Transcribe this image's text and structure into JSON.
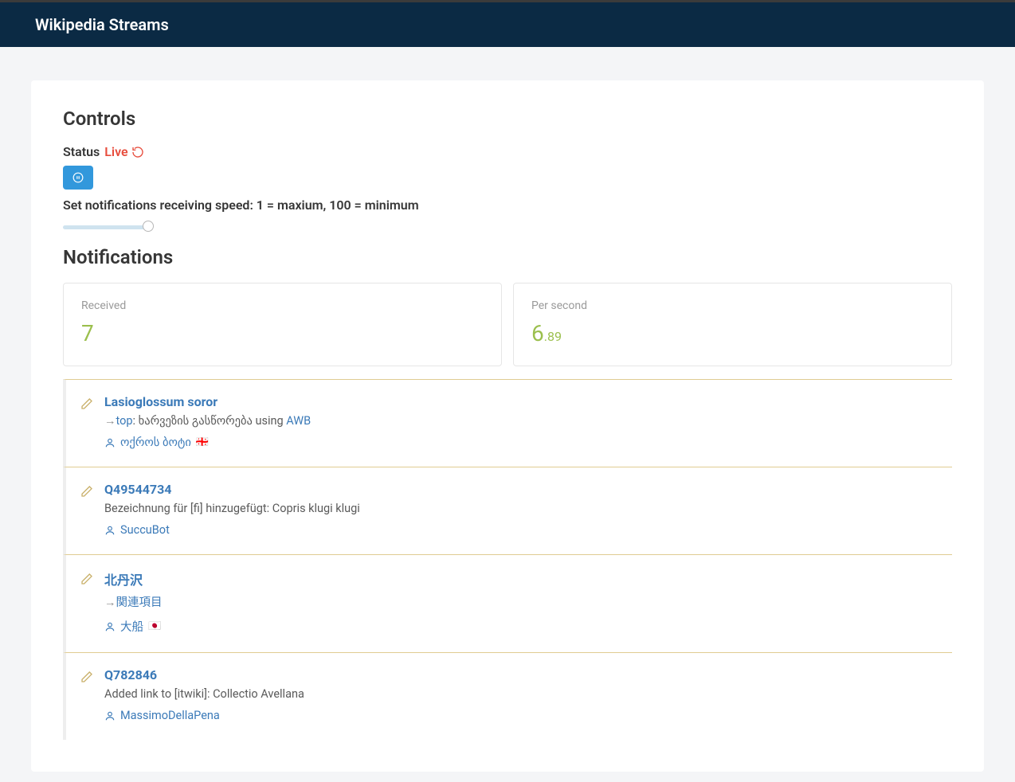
{
  "header": {
    "title": "Wikipedia Streams"
  },
  "controls": {
    "section_title": "Controls",
    "status_label": "Status",
    "status_value": "Live",
    "speed_label": "Set notifications receiving speed: 1 = maxium, 100 = minimum",
    "slider_value": 100
  },
  "notifications": {
    "section_title": "Notifications",
    "stats": {
      "received_label": "Received",
      "received_value": "7",
      "persec_label": "Per second",
      "persec_big": "6",
      "persec_small": ".89"
    },
    "items": [
      {
        "title": "Lasioglossum soror",
        "desc_prefix_arrow": "→",
        "desc_link1": "top",
        "desc_mid": ": ხარვეზის გასწორება using ",
        "desc_link2": "AWB",
        "user": "ოქროს ბოტი",
        "flag": "🇬🇪"
      },
      {
        "title": "Q49544734",
        "desc_plain": "Bezeichnung für [fi] hinzugefügt: Copris klugi klugi",
        "user": "SuccuBot",
        "flag": ""
      },
      {
        "title": "北丹沢",
        "desc_prefix_arrow": "→",
        "desc_link1": "関連項目",
        "user": "大船",
        "flag": "🇯🇵"
      },
      {
        "title": "Q782846",
        "desc_plain": "Added link to [itwiki]: Collectio Avellana",
        "user": "MassimoDellaPena",
        "flag": ""
      }
    ]
  }
}
